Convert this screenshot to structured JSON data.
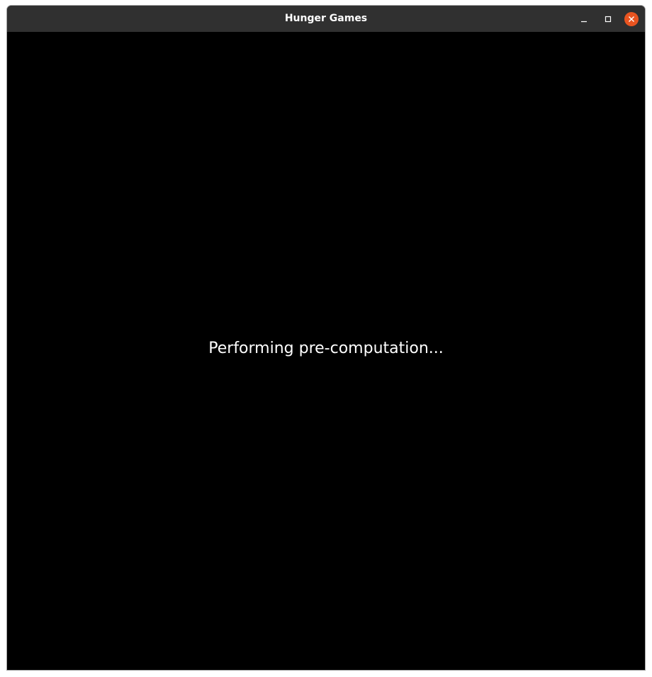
{
  "window": {
    "title": "Hunger Games",
    "controls": {
      "minimize_icon": "minimize-icon",
      "maximize_icon": "maximize-icon",
      "close_icon": "close-icon"
    },
    "colors": {
      "titlebar": "#303030",
      "close_button": "#e95420",
      "canvas": "#000000"
    }
  },
  "canvas": {
    "status_text": "Performing pre-computation..."
  }
}
